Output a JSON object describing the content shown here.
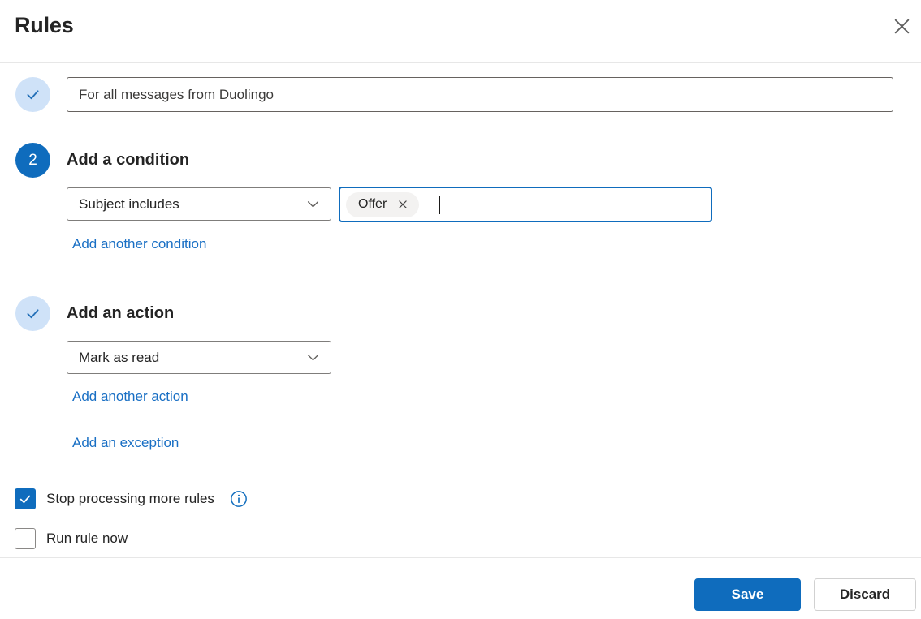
{
  "dialog": {
    "title": "Rules"
  },
  "name_step": {
    "status": "completed",
    "value": "For all messages from Duolingo"
  },
  "condition_step": {
    "number": "2",
    "heading": "Add a condition",
    "select": {
      "selected": "Subject includes"
    },
    "value_input": {
      "tags": [
        {
          "label": "Offer"
        }
      ],
      "focused": true
    },
    "add_link": "Add another condition"
  },
  "action_step": {
    "status": "completed",
    "heading": "Add an action",
    "select": {
      "selected": "Mark as read"
    },
    "add_link": "Add another action"
  },
  "exception_link": "Add an exception",
  "options": {
    "stop_processing": {
      "label": "Stop processing more rules",
      "checked": true,
      "has_info_icon": true
    },
    "run_rule_now": {
      "label": "Run rule now",
      "checked": false
    }
  },
  "footer": {
    "save": "Save",
    "discard": "Discard"
  },
  "icons": {
    "close": "✕",
    "chevron_down": "⌄",
    "checkmark": "✓",
    "info": "ⓘ",
    "remove_tag": "✕"
  },
  "colors": {
    "accent": "#0f6cbd",
    "link": "#196fc4",
    "step_done_bg": "#cfe2f8",
    "step_done_check": "#2470b8",
    "tag_bg": "#f3f2f1",
    "input_border": "#66625f",
    "select_border": "#7f7d7b",
    "divider": "#e7e7e7",
    "text": "#242424",
    "muted_text": "#3b3a39"
  }
}
